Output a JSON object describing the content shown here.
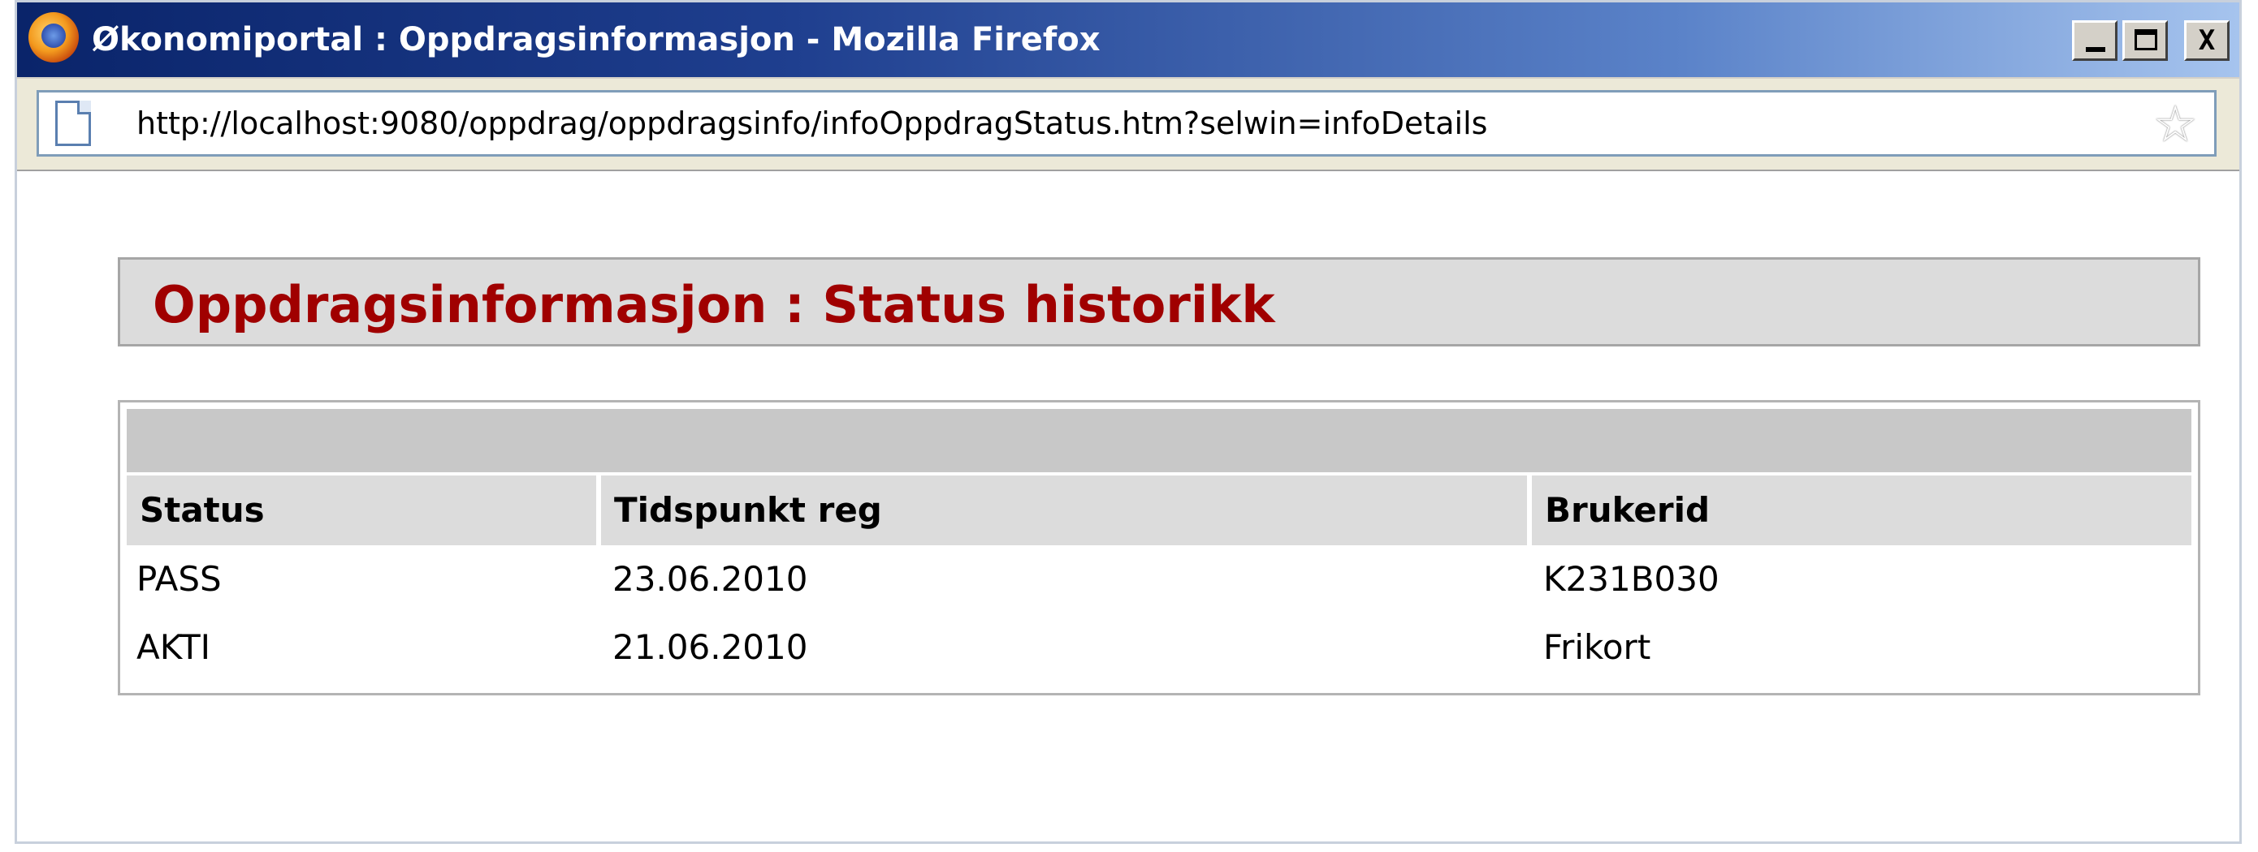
{
  "window": {
    "title": "Økonomiportal : Oppdragsinformasjon - Mozilla Firefox",
    "controls": {
      "minimize": "_",
      "maximize": "□",
      "close": "X"
    }
  },
  "address_bar": {
    "url": "http://localhost:9080/oppdrag/oppdragsinfo/infoOppdragStatus.htm?selwin=infoDetails",
    "page_icon": "page-icon",
    "bookmark_icon": "star-icon",
    "bookmark_glyph": "☆"
  },
  "page": {
    "heading": "Oppdragsinformasjon : Status historikk",
    "heading_color": "#a00000"
  },
  "table": {
    "columns": [
      "Status",
      "Tidspunkt reg",
      "Brukerid"
    ],
    "rows": [
      [
        "PASS",
        "23.06.2010",
        "K231B030"
      ],
      [
        "AKTI",
        "21.06.2010",
        "Frikort"
      ]
    ]
  }
}
